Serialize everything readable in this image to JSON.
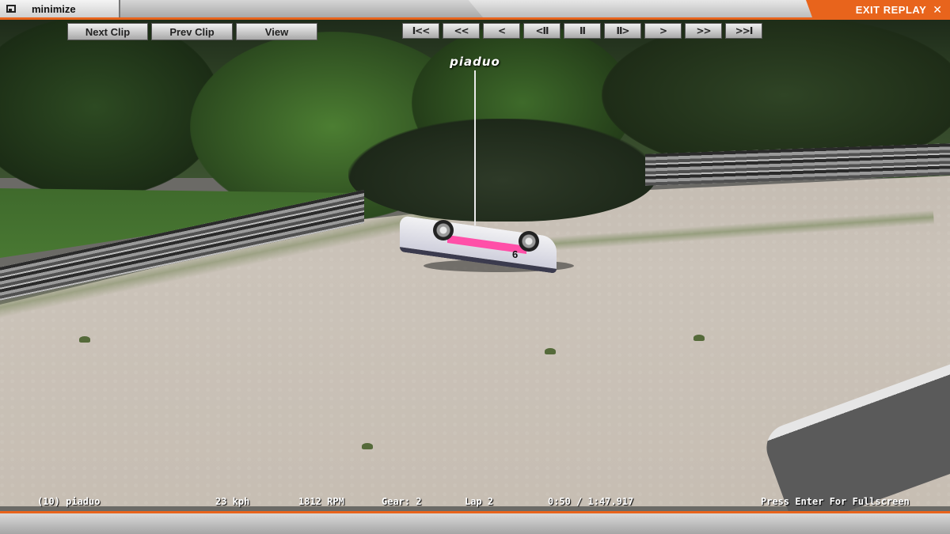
{
  "topbar": {
    "minimize_label": "minimize",
    "exit_label": "EXIT REPLAY",
    "exit_icon": "close-x-icon",
    "accent_color": "#e8641c"
  },
  "clip_buttons": {
    "next_clip": "Next Clip",
    "prev_clip": "Prev Clip",
    "view": "View"
  },
  "playback": {
    "skip_start": "I<<",
    "rewind_fast": "<<",
    "rewind": "<",
    "step_back": "<II",
    "pause": "II",
    "step_forward": "II>",
    "play": ">",
    "fast_forward": ">>",
    "skip_end": ">>I"
  },
  "driver": {
    "name": "piaduo"
  },
  "status": {
    "driver": "(10) piaduo",
    "speed": "23 kph",
    "rpm": "1812 RPM",
    "gear": "Gear: 2",
    "lap": "Lap 2",
    "time": "0:50 / 1:47.917",
    "hint": "Press Enter For Fullscreen"
  },
  "car": {
    "number": "6"
  }
}
